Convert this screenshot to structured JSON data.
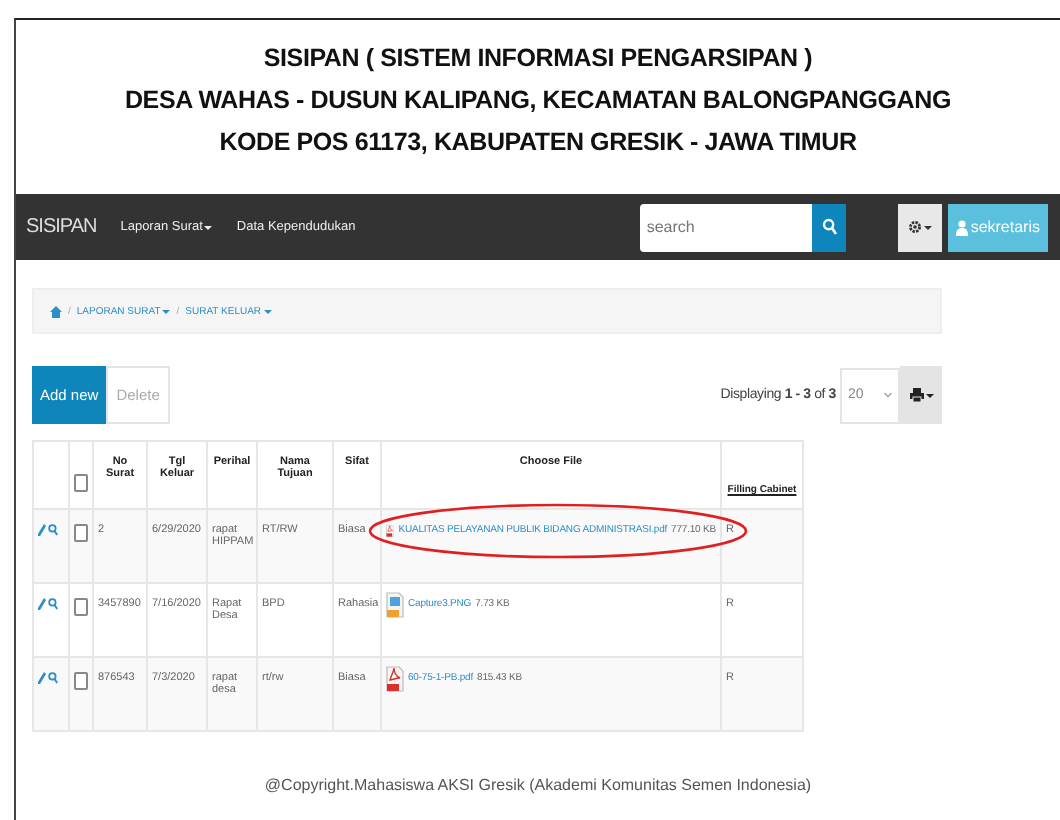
{
  "header": {
    "lines": [
      "SISIPAN ( SISTEM INFORMASI PENGARSIPAN )",
      "DESA WAHAS - DUSUN KALIPANG, KECAMATAN BALONGPANGGANG",
      "KODE POS 61173, KABUPATEN GRESIK - JAWA TIMUR"
    ]
  },
  "navbar": {
    "brand": "SISIPAN",
    "menu": [
      {
        "label": "Laporan Surat",
        "dropdown": true
      },
      {
        "label": "Data Kependudukan",
        "dropdown": false
      }
    ],
    "search": {
      "placeholder": "search"
    },
    "user": "sekretaris"
  },
  "breadcrumb": [
    {
      "separator": "/",
      "label": "LAPORAN SURAT",
      "dropdown": true
    },
    {
      "separator": "/",
      "label": "SURAT KELUAR",
      "dropdown": true
    }
  ],
  "toolbar": {
    "add": "Add new",
    "delete": "Delete",
    "displaying": "Displaying **1 - 3** of **3**",
    "page_size": "20"
  },
  "table": {
    "columns": [
      "No Surat",
      "Tgl Keluar",
      "Perihal",
      "Nama Tujuan",
      "Sifat",
      "Choose File",
      "Filling Cabinet"
    ],
    "select_all_checked": false,
    "rows": [
      {
        "checked": false,
        "no": "2",
        "tgl": "6/29/2020",
        "perihal": "rapat HIPPAM",
        "nama": "RT/RW",
        "sifat": "Biasa",
        "file": {
          "kind": "pdf",
          "name": "KUALITAS PELAYANAN PUBLIK BIDANG ADMINISTRASI.pdf",
          "size": "777.10 KB"
        },
        "filling": "R",
        "annotated": true
      },
      {
        "checked": false,
        "no": "3457890",
        "tgl": "7/16/2020",
        "perihal": "Rapat Desa",
        "nama": "BPD",
        "sifat": "Rahasia",
        "file": {
          "kind": "png",
          "name": "Capture3.PNG",
          "size": "7.73 KB"
        },
        "filling": "R",
        "annotated": false
      },
      {
        "checked": false,
        "no": "876543",
        "tgl": "7/3/2020",
        "perihal": "rapat desa",
        "nama": "rt/rw",
        "sifat": "Biasa",
        "file": {
          "kind": "pdf",
          "name": "60-75-1-PB.pdf",
          "size": "815.43 KB"
        },
        "filling": "R",
        "annotated": false
      }
    ]
  },
  "footer": "@Copyright.Mahasiswa AKSI Gresik (Akademi Komunitas Semen Indonesia)"
}
